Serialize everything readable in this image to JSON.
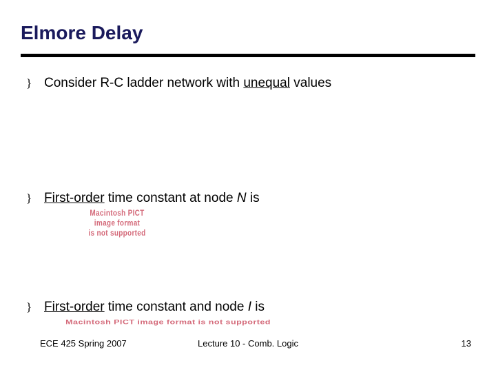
{
  "title": "Elmore Delay",
  "bullets": [
    {
      "prefix": "Consider R-C ladder network with ",
      "underlined": "unequal",
      "suffix": " values"
    },
    {
      "underlined": "First-order",
      "mid": " time constant at node ",
      "italic": "N",
      "suffix": "  is"
    },
    {
      "underlined": "First-order",
      "mid": " time constant and node ",
      "italic": "I",
      "suffix": " is"
    }
  ],
  "pict_lines": [
    "Macintosh PICT",
    "image format",
    "is not supported"
  ],
  "pict2_text": "Macintosh PICT image format is not supported",
  "bullet_marker": "}",
  "footer": {
    "left": "ECE 425 Spring 2007",
    "center": "Lecture 10 - Comb. Logic",
    "right": "13"
  }
}
